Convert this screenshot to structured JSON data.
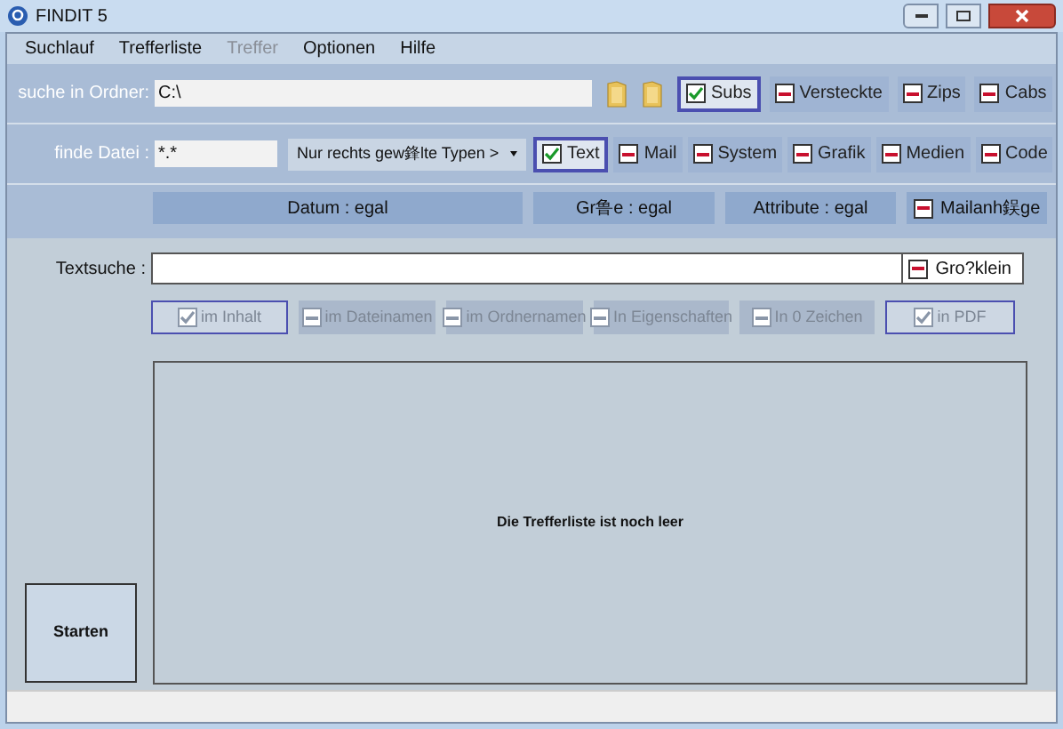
{
  "window": {
    "title": "FINDIT  5"
  },
  "menu": [
    {
      "label": "Suchlauf",
      "disabled": false
    },
    {
      "label": "Trefferliste",
      "disabled": false
    },
    {
      "label": "Treffer",
      "disabled": true
    },
    {
      "label": "Optionen",
      "disabled": false
    },
    {
      "label": "Hilfe",
      "disabled": false
    }
  ],
  "folder_row": {
    "label": "suche in Ordner:",
    "value": "C:\\",
    "options": [
      {
        "label": "Subs",
        "checked": true
      },
      {
        "label": "Versteckte",
        "checked": false
      },
      {
        "label": "Zips",
        "checked": false
      },
      {
        "label": "Cabs",
        "checked": false
      }
    ]
  },
  "file_row": {
    "label": "finde Datei :",
    "value": "*.*",
    "dropdown": "Nur rechts gew鋒lte Typen >",
    "types": [
      {
        "label": "Text",
        "checked": true
      },
      {
        "label": "Mail",
        "checked": false
      },
      {
        "label": "System",
        "checked": false
      },
      {
        "label": "Grafik",
        "checked": false
      },
      {
        "label": "Medien",
        "checked": false
      },
      {
        "label": "Code",
        "checked": false
      }
    ]
  },
  "filters": [
    {
      "kind": "button",
      "label": "Datum : egal"
    },
    {
      "kind": "button",
      "label": "Gr鲁e : egal"
    },
    {
      "kind": "button",
      "label": "Attribute : egal"
    },
    {
      "kind": "checkbox",
      "label": "Mailanh鋘ge",
      "checked": false
    }
  ],
  "text_search": {
    "label": "Textsuche :",
    "case": {
      "label": "Gro?klein",
      "checked": false
    },
    "scopes": [
      {
        "label": "im Inhalt",
        "checked": true
      },
      {
        "label": "im Dateinamen",
        "checked": false
      },
      {
        "label": "im Ordnernamen",
        "checked": false
      },
      {
        "label": "In Eigenschaften",
        "checked": false
      },
      {
        "label": "In 0 Zeichen",
        "checked": false
      },
      {
        "label": "in PDF",
        "checked": true
      }
    ]
  },
  "results": {
    "message": "Die Trefferliste ist noch leer"
  },
  "start_button": "Starten"
}
